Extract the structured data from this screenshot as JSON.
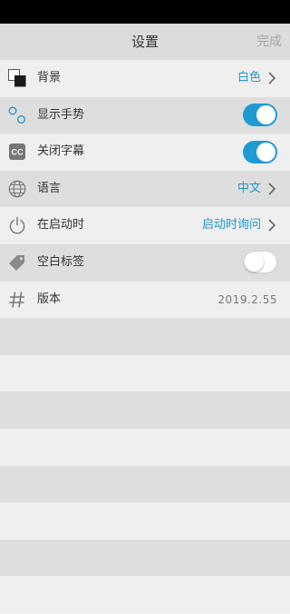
{
  "header": {
    "title": "设置",
    "done_label": "完成"
  },
  "settings": {
    "background": {
      "label": "背景",
      "value": "白色"
    },
    "gestures": {
      "label": "显示手势",
      "enabled": true
    },
    "captions": {
      "label": "关闭字幕",
      "enabled": true
    },
    "language": {
      "label": "语言",
      "value": "中文"
    },
    "startup": {
      "label": "在启动时",
      "value": "启动时询问"
    },
    "blank_tab": {
      "label": "空白标签",
      "enabled": false
    },
    "version": {
      "label": "版本",
      "value": "2019.2.55"
    }
  },
  "colors": {
    "accent": "#1e9bd3",
    "header_bg": "#dcdcdc",
    "row_dark": "#dedede",
    "row_light": "#efefef"
  },
  "icons": [
    "background-icon",
    "gesture-icon",
    "cc-icon",
    "globe-icon",
    "power-icon",
    "tag-icon",
    "hash-icon",
    "chevron-right-icon"
  ]
}
